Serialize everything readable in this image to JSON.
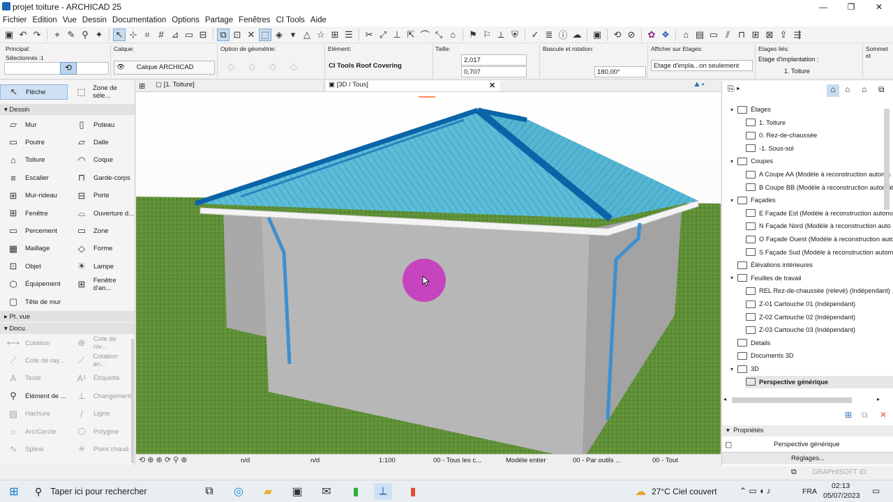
{
  "window": {
    "title": "projet toiture - ARCHICAD 25",
    "minimize": "—",
    "maximize": "❐",
    "close": "✕"
  },
  "menu": [
    "Fichier",
    "Edition",
    "Vue",
    "Dessin",
    "Documentation",
    "Options",
    "Partage",
    "Fenêtres",
    "CI Tools",
    "Aide"
  ],
  "infobox": {
    "principal_label": "Principal:",
    "selected": "Sélectionnés :1",
    "calque_label": "Calque:",
    "calque_value": "Calque ARCHICAD",
    "geom_label": "Option de géométrie:",
    "element_label": "Elément:",
    "element_value": "CI Tools Roof Covering",
    "size_label": "Taille:",
    "size_w": "2,017",
    "size_h": "0,707",
    "rotation_label": "Bascule et rotation:",
    "rotation_value": "180,00°",
    "show_on_label": "Afficher sur Etages:",
    "show_on_value": "Etage d'impla...on seulement",
    "linked_label": "Etages liés:",
    "home_story_label": "Etage d'implantation :",
    "home_story_value": "1. Toiture",
    "top_label": "Sommet et"
  },
  "toolbox": {
    "arrow": "Flèche",
    "marquee": "Zone de séle...",
    "group_dessin": "Dessin",
    "tools_left": [
      "Mur",
      "Poutre",
      "Toiture",
      "Escalier",
      "Mur-rideau",
      "Fenêtre",
      "Percement",
      "Maillage",
      "Objet",
      "Équipement",
      "Tête de mur"
    ],
    "tools_right": [
      "Poteau",
      "Dalle",
      "Coque",
      "Garde-corps",
      "Porte",
      "Ouverture d...",
      "Zone",
      "Forme",
      "Lampe",
      "Fenêtre d'an..."
    ],
    "group_ptvue": "Pt. vue",
    "group_docu": "Docu.",
    "docu_left": [
      "Cotation",
      "Cote de ray...",
      "Texte",
      "Élément de ...",
      "Hachure",
      "Arc/Cercle",
      "Spline"
    ],
    "docu_right": [
      "Cote de niv...",
      "Cotation an...",
      "Étiquette",
      "Changement",
      "Ligne",
      "Polygine",
      "Point chaud"
    ]
  },
  "tabs": {
    "plan": "[1. Toiture]",
    "view3d": "[3D / Tous]"
  },
  "status": {
    "nd1": "n/d",
    "nd2": "n/d",
    "scale": "1:100",
    "layers": "00 - Tous les c...",
    "model": "Modèle entier",
    "pen": "00 - Par outils ...",
    "dim": "00 - Tout"
  },
  "navigator": {
    "stories_label": "Étages",
    "stories": [
      "1. Toiture",
      "0. Rez-de-chaussée",
      "-1. Sous-sol"
    ],
    "sections_label": "Coupes",
    "sections": [
      "A Coupe AA (Modèle à reconstruction automa",
      "B Coupe BB (Modèle à reconstruction automat"
    ],
    "elevations_label": "Façades",
    "elevations": [
      "E Façade Est (Modèle à reconstruction automa",
      "N Façade Nord (Modèle à reconstruction auto",
      "O Façade Ouest (Modèle à reconstruction auto",
      "S Façade Sud (Modèle à reconstruction autom"
    ],
    "interior": "Élévations intérieures",
    "worksheets_label": "Feuilles de travail",
    "worksheets": [
      "REL Rez-de-chaussée (relevé) (Indépendant)",
      "Z-01 Cartouche 01 (Indépendant)",
      "Z-02 Cartouche 02 (Indépendant)",
      "Z-03 Cartouche 03 (Indépendant)"
    ],
    "details": "Détails",
    "docs3d": "Documents 3D",
    "label3d": "3D",
    "generic": "Perspective générique",
    "props_label": "Propriétés",
    "props_value": "Perspective générique",
    "settings": "Réglages...",
    "brand": "GRAPHISOFT ID"
  },
  "taskbar": {
    "search": "Taper ici pour rechercher",
    "weather": "27°C  Ciel couvert",
    "lang": "FRA",
    "time": "02:13",
    "date": "05/07/2023"
  },
  "colors": {
    "roof": "#4ab6d6",
    "ridge": "#0b64a8",
    "wall": "#b5b5b5",
    "grass": "#5e8c36",
    "cursor": "#c92cc0"
  }
}
